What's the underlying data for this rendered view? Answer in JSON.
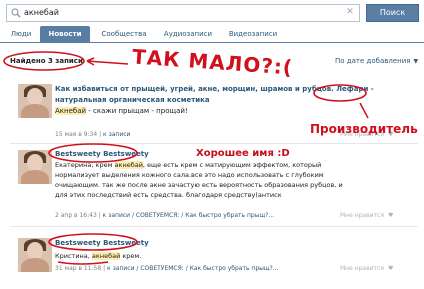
{
  "search": {
    "query": "акнебай",
    "button_label": "Поиск"
  },
  "tabs": [
    {
      "label": "Люди",
      "active": false
    },
    {
      "label": "Новости",
      "active": true
    },
    {
      "label": "Сообщества",
      "active": false
    },
    {
      "label": "Аудиозаписи",
      "active": false
    },
    {
      "label": "Видеозаписи",
      "active": false
    }
  ],
  "results": {
    "found_label": "Найдено 3 записи",
    "sort_label": "По дате добавления"
  },
  "posts": [
    {
      "title": "Как избавиться от прыщей, угрей, акне, морщин, шрамов и рубцов. Лефари - натуральная органическая косметика",
      "highlight": "Акнебай",
      "subtitle_rest": " - скажи прыщам - прощай!",
      "meta_time": "15 мая в 9:34",
      "meta_link": "к записи",
      "like_label": "Мне нравится"
    },
    {
      "author": "Bestsweety Bestsweety",
      "text_before": "Екатерина, крем ",
      "highlight": "акнебай",
      "text_after": ", еще есть крем с матирующим эффектом, который нормализует выделения кожного сала.все это надо использовать с глубоким очищающим. так же после акне зачастую есть вероятность образования рубцов, и для этих последствий есть средства. благодаря средству(антиск",
      "meta_time": "2 апр в 16:43",
      "meta_link": "к записи",
      "meta_group": "/ СОВЕТУЕМСЯ: / Как быстро убрать прыщ?...",
      "like_label": "Мне нравится"
    },
    {
      "author": "Bestsweety Bestsweety",
      "text_before": "Кристина, ",
      "highlight": "акнебай",
      "text_after": " крем.",
      "meta_time": "31 мар в 11:58",
      "meta_link": "к записи",
      "meta_group": "/ СОВЕТУЕМСЯ: / Как быстро убрать прыщ?...",
      "like_label": "Мне нравится"
    }
  ],
  "annotations": {
    "too_few": "ТАК МАЛО?:(",
    "good_name": "Хорошее имя :D",
    "manufacturer": "Производитель"
  },
  "colors": {
    "accent": "#597da3",
    "link": "#2b587a",
    "highlight": "#fcedb0",
    "annotation": "#d0101c"
  }
}
